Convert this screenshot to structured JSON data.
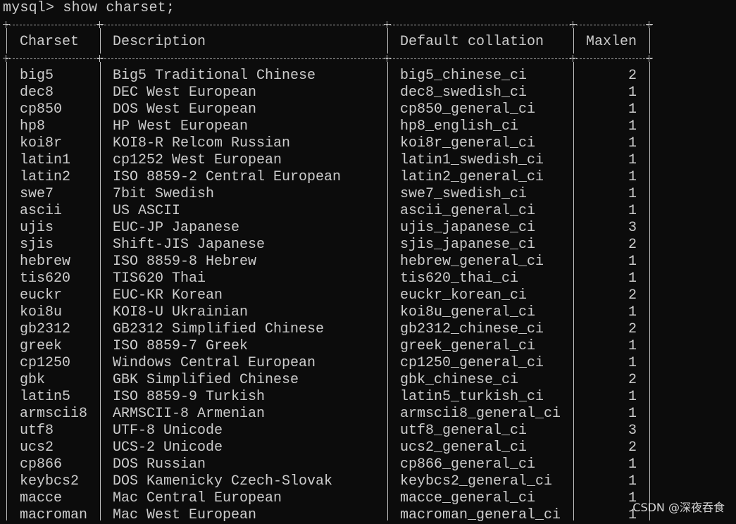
{
  "terminal": {
    "prompt": "mysql> ",
    "command": "show charset;"
  },
  "table": {
    "headers": [
      "Charset",
      "Description",
      "Default collation",
      "Maxlen"
    ],
    "rows": [
      [
        "big5",
        "Big5 Traditional Chinese",
        "big5_chinese_ci",
        "2"
      ],
      [
        "dec8",
        "DEC West European",
        "dec8_swedish_ci",
        "1"
      ],
      [
        "cp850",
        "DOS West European",
        "cp850_general_ci",
        "1"
      ],
      [
        "hp8",
        "HP West European",
        "hp8_english_ci",
        "1"
      ],
      [
        "koi8r",
        "KOI8-R Relcom Russian",
        "koi8r_general_ci",
        "1"
      ],
      [
        "latin1",
        "cp1252 West European",
        "latin1_swedish_ci",
        "1"
      ],
      [
        "latin2",
        "ISO 8859-2 Central European",
        "latin2_general_ci",
        "1"
      ],
      [
        "swe7",
        "7bit Swedish",
        "swe7_swedish_ci",
        "1"
      ],
      [
        "ascii",
        "US ASCII",
        "ascii_general_ci",
        "1"
      ],
      [
        "ujis",
        "EUC-JP Japanese",
        "ujis_japanese_ci",
        "3"
      ],
      [
        "sjis",
        "Shift-JIS Japanese",
        "sjis_japanese_ci",
        "2"
      ],
      [
        "hebrew",
        "ISO 8859-8 Hebrew",
        "hebrew_general_ci",
        "1"
      ],
      [
        "tis620",
        "TIS620 Thai",
        "tis620_thai_ci",
        "1"
      ],
      [
        "euckr",
        "EUC-KR Korean",
        "euckr_korean_ci",
        "2"
      ],
      [
        "koi8u",
        "KOI8-U Ukrainian",
        "koi8u_general_ci",
        "1"
      ],
      [
        "gb2312",
        "GB2312 Simplified Chinese",
        "gb2312_chinese_ci",
        "2"
      ],
      [
        "greek",
        "ISO 8859-7 Greek",
        "greek_general_ci",
        "1"
      ],
      [
        "cp1250",
        "Windows Central European",
        "cp1250_general_ci",
        "1"
      ],
      [
        "gbk",
        "GBK Simplified Chinese",
        "gbk_chinese_ci",
        "2"
      ],
      [
        "latin5",
        "ISO 8859-9 Turkish",
        "latin5_turkish_ci",
        "1"
      ],
      [
        "armscii8",
        "ARMSCII-8 Armenian",
        "armscii8_general_ci",
        "1"
      ],
      [
        "utf8",
        "UTF-8 Unicode",
        "utf8_general_ci",
        "3"
      ],
      [
        "ucs2",
        "UCS-2 Unicode",
        "ucs2_general_ci",
        "2"
      ],
      [
        "cp866",
        "DOS Russian",
        "cp866_general_ci",
        "1"
      ],
      [
        "keybcs2",
        "DOS Kamenicky Czech-Slovak",
        "keybcs2_general_ci",
        "1"
      ],
      [
        "macce",
        "Mac Central European",
        "macce_general_ci",
        "1"
      ],
      [
        "macroman",
        "Mac West European",
        "macroman_general_ci",
        "1"
      ]
    ]
  },
  "watermark": "CSDN @深夜吞食",
  "colors": {
    "background": "#0c0c0c",
    "text": "#cccccc"
  }
}
